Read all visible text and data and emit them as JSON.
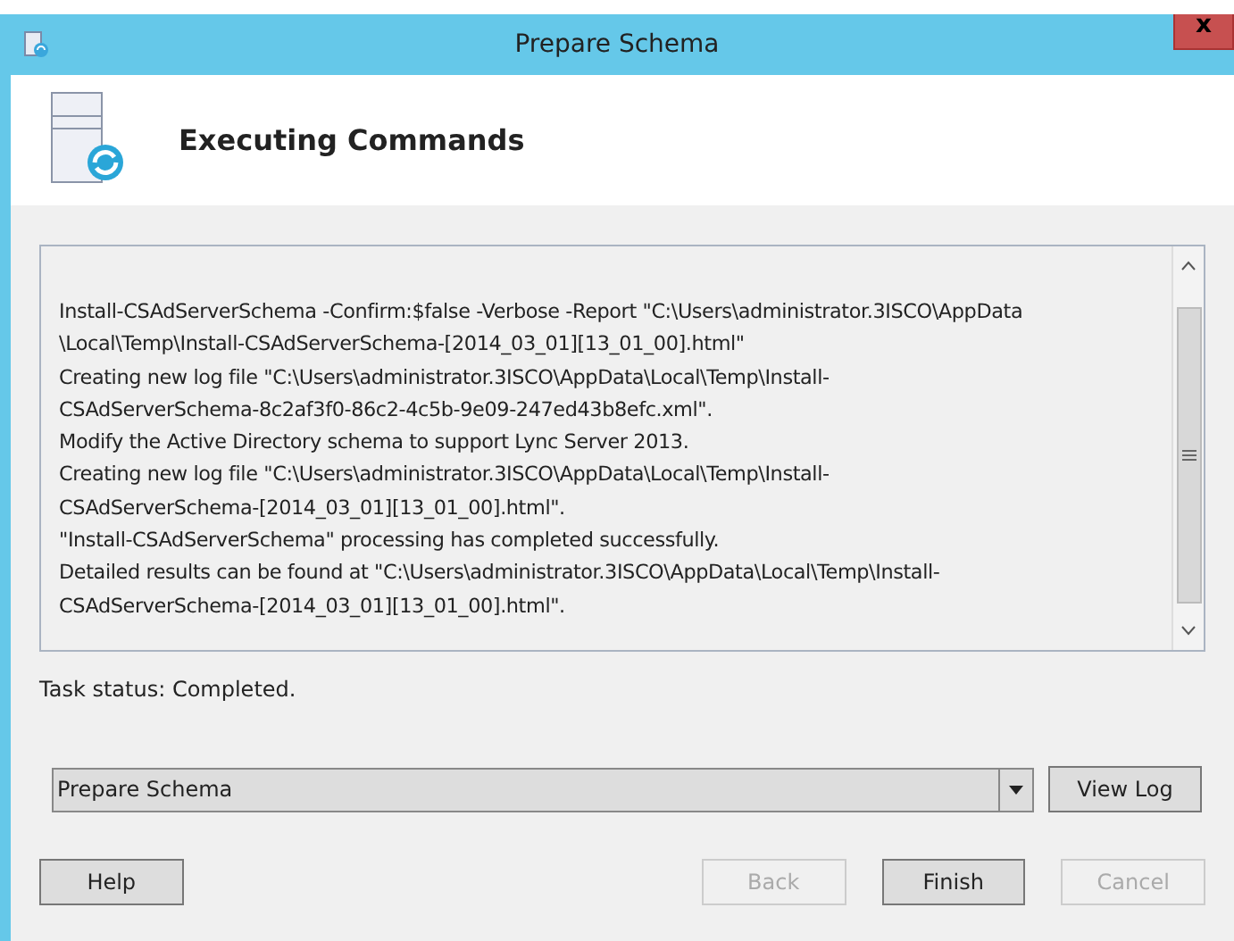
{
  "window": {
    "title": "Prepare Schema",
    "close": "x"
  },
  "header": {
    "title": "Executing Commands"
  },
  "log": {
    "lines": [
      "Install-CSAdServerSchema -Confirm:$false -Verbose -Report \"C:\\Users\\administrator.3ISCO\\AppData",
      "\\Local\\Temp\\Install-CSAdServerSchema-[2014_03_01][13_01_00].html\"",
      "Creating new log file \"C:\\Users\\administrator.3ISCO\\AppData\\Local\\Temp\\Install-",
      "CSAdServerSchema-8c2af3f0-86c2-4c5b-9e09-247ed43b8efc.xml\".",
      "Modify the Active Directory schema to support Lync Server 2013.",
      "Creating new log file \"C:\\Users\\administrator.3ISCO\\AppData\\Local\\Temp\\Install-",
      "CSAdServerSchema-[2014_03_01][13_01_00].html\".",
      "\"Install-CSAdServerSchema\" processing has completed successfully.",
      "Detailed results can be found at \"C:\\Users\\administrator.3ISCO\\AppData\\Local\\Temp\\Install-",
      "CSAdServerSchema-[2014_03_01][13_01_00].html\"."
    ]
  },
  "task_status": "Task status: Completed.",
  "task_select": {
    "value": "Prepare Schema"
  },
  "view_log": "View Log",
  "buttons": [
    {
      "label": "Help",
      "disabled": false
    },
    {
      "label": "Back",
      "disabled": true
    },
    {
      "label": "Finish",
      "disabled": false
    },
    {
      "label": "Cancel",
      "disabled": true
    }
  ]
}
